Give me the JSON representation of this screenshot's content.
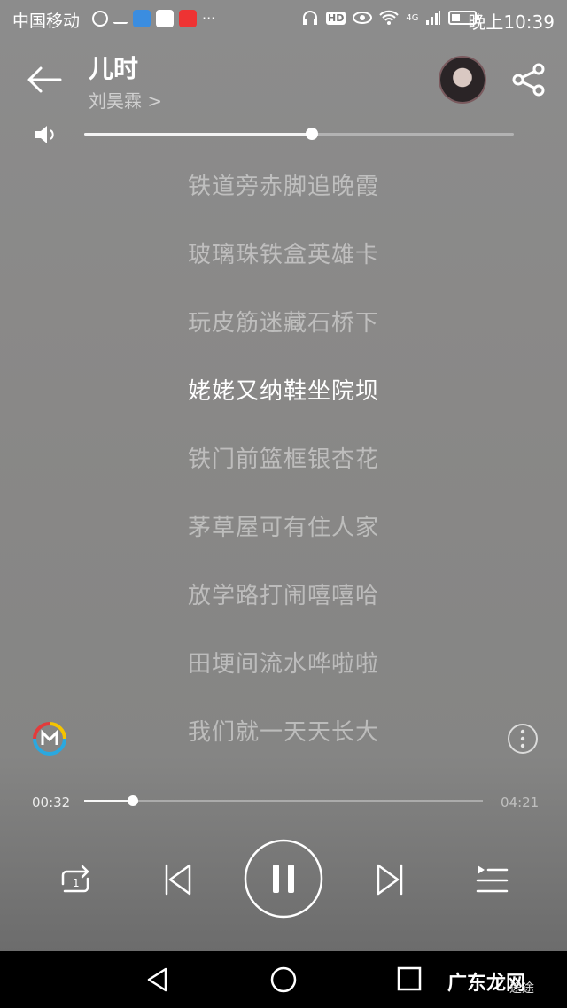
{
  "status_bar": {
    "carrier": "中国移动",
    "time": "晚上10:39",
    "hd_badge": "HD",
    "network": "4G"
  },
  "song": {
    "title": "儿时",
    "artist": "刘昊霖 >"
  },
  "volume": {
    "level": 0.53
  },
  "lyrics": [
    "铁道旁赤脚追晚霞",
    "玻璃珠铁盒英雄卡",
    "玩皮筋迷藏石桥下",
    "姥姥又纳鞋坐院坝",
    "铁门前篮框银杏花",
    "茅草屋可有住人家",
    "放学路打闹嘻嘻哈",
    "田埂间流水哗啦啦",
    "我们就一天天长大"
  ],
  "current_lyric_index": 3,
  "playback": {
    "current_time": "00:32",
    "total_time": "04:21",
    "progress": 0.123
  },
  "controls": {
    "repeat_mode": "1"
  },
  "watermark": {
    "text": "广东龙网",
    "sub": "途途"
  }
}
